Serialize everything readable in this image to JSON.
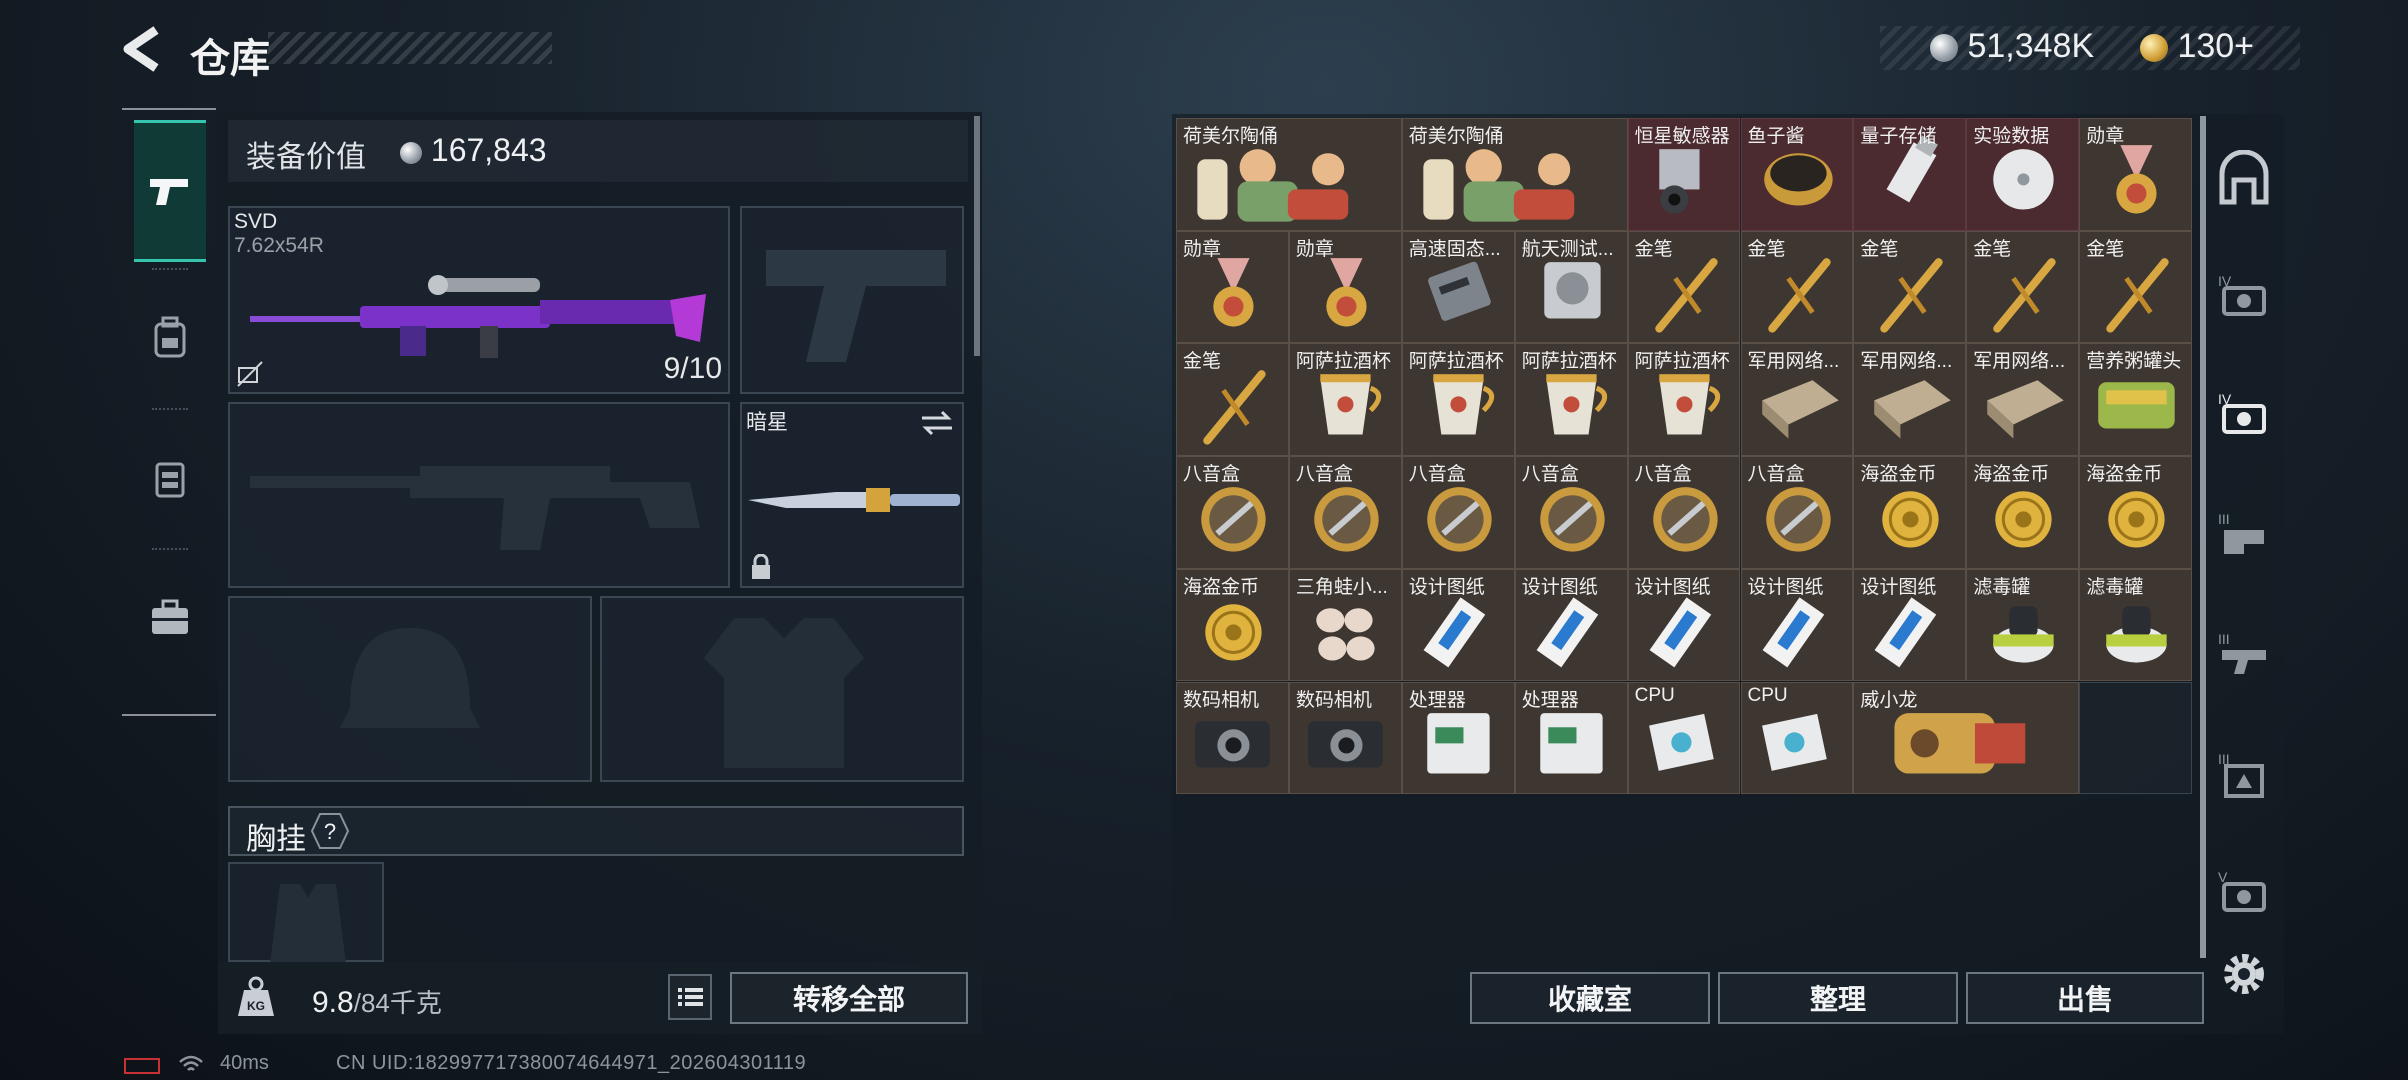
{
  "header": {
    "title": "仓库",
    "currency_silver": "51,348K",
    "currency_gold": "130+"
  },
  "equipment": {
    "value_label": "装备价值",
    "value": "167,843",
    "primary_weapon": {
      "name": "SVD",
      "ammo": "7.62x54R",
      "durability": "9/10"
    },
    "melee": {
      "name": "暗星"
    },
    "chest_label": "胸挂",
    "chest_help": "?",
    "weight": "9.8",
    "weight_max": "/84千克",
    "transfer_all": "转移全部"
  },
  "storage": {
    "rows": [
      [
        "荷美尔陶俑",
        "荷美尔陶俑",
        "恒星敏感器",
        "鱼子酱",
        "量子存储",
        "实验数据",
        "勋章"
      ],
      [
        "勋章",
        "勋章",
        "高速固态...",
        "航天测试...",
        "金笔",
        "金笔",
        "金笔",
        "金笔",
        "金笔"
      ],
      [
        "金笔",
        "阿萨拉酒杯",
        "阿萨拉酒杯",
        "阿萨拉酒杯",
        "阿萨拉酒杯",
        "军用网络...",
        "军用网络...",
        "军用网络...",
        "营养粥罐头"
      ],
      [
        "八音盒",
        "八音盒",
        "八音盒",
        "八音盒",
        "八音盒",
        "八音盒",
        "海盗金币",
        "海盗金币",
        "海盗金币"
      ],
      [
        "海盗金币",
        "三角蛙小...",
        "设计图纸",
        "设计图纸",
        "设计图纸",
        "设计图纸",
        "设计图纸",
        "滤毒罐",
        "滤毒罐"
      ],
      [
        "数码相机",
        "数码相机",
        "处理器",
        "处理器",
        "CPU",
        "CPU",
        "威小龙"
      ]
    ],
    "buttons": {
      "collection": "收藏室",
      "organize": "整理",
      "sell": "出售"
    }
  },
  "status": {
    "ping": "40ms",
    "uid": "CN UID:18299771738007464​4971_202604301119"
  },
  "colors": {
    "accent": "#35c4ad",
    "item_bg": "#3e3631",
    "rare_bg": "#4b2a30"
  }
}
